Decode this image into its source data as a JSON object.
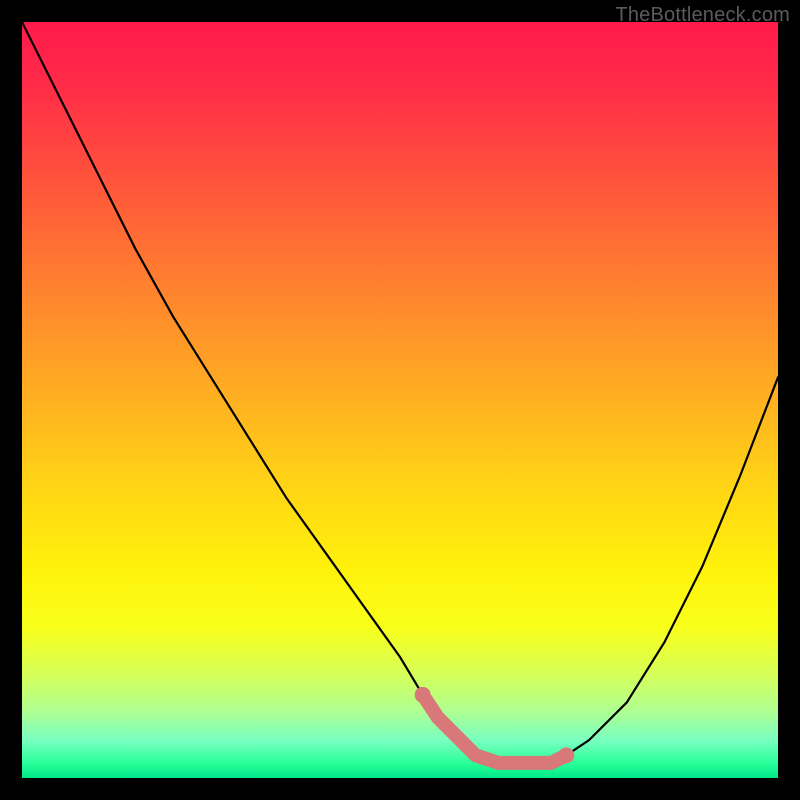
{
  "watermark": "TheBottleneck.com",
  "chart_data": {
    "type": "line",
    "title": "",
    "xlabel": "",
    "ylabel": "",
    "xlim": [
      0,
      100
    ],
    "ylim": [
      0,
      100
    ],
    "series": [
      {
        "name": "curve",
        "x": [
          0,
          5,
          10,
          15,
          20,
          25,
          30,
          35,
          40,
          45,
          50,
          53,
          55,
          58,
          60,
          63,
          66,
          70,
          72,
          75,
          80,
          85,
          90,
          95,
          100
        ],
        "y": [
          100,
          90,
          80,
          70,
          61,
          53,
          45,
          37,
          30,
          23,
          16,
          11,
          8,
          5,
          3,
          2,
          2,
          2,
          3,
          5,
          10,
          18,
          28,
          40,
          53
        ]
      }
    ],
    "highlight_band": {
      "name": "optimum-band",
      "color": "#d87878",
      "x_start": 53,
      "x_end": 72
    }
  }
}
